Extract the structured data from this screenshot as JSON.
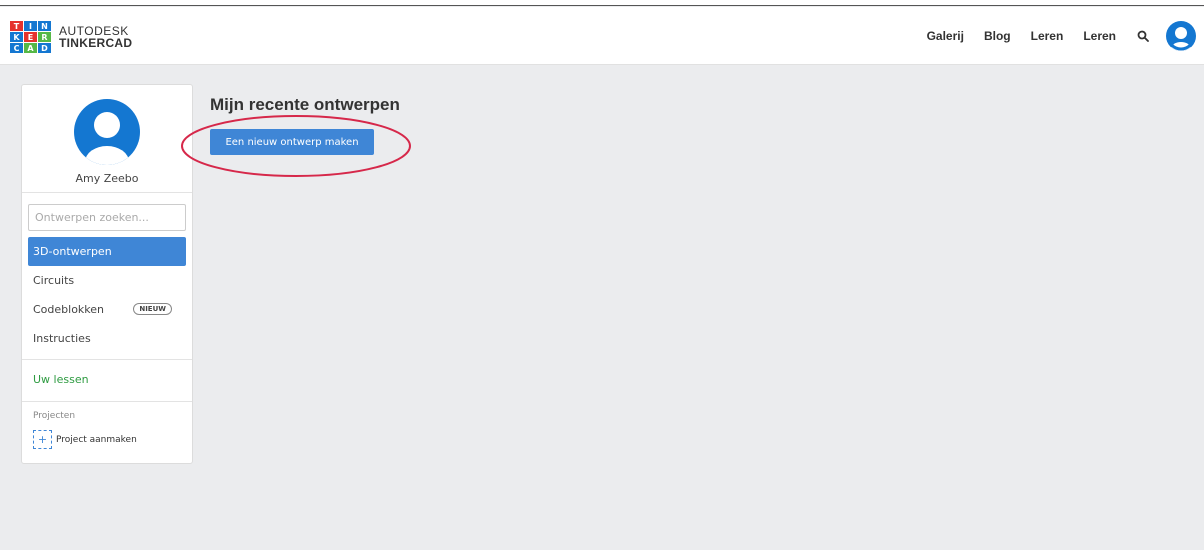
{
  "logo": {
    "letters": [
      "T",
      "I",
      "N",
      "K",
      "E",
      "R",
      "C",
      "A",
      "D"
    ],
    "line1": "AUTODESK",
    "line2": "TINKERCAD",
    "colors": [
      "#e5322d",
      "#1477d1",
      "#1477d1",
      "#1477d1",
      "#e5322d",
      "#56b847",
      "#1477d1",
      "#56b847",
      "#1477d1"
    ]
  },
  "nav": {
    "items": [
      "Galerij",
      "Blog",
      "Leren",
      "Leren"
    ],
    "search_icon": "search-icon",
    "avatar_icon": "user-avatar-icon"
  },
  "profile": {
    "name": "Amy Zeebo",
    "avatar_icon": "user-avatar-icon"
  },
  "search": {
    "placeholder": "Ontwerpen zoeken..."
  },
  "menu": {
    "items": [
      {
        "label": "3D-ontwerpen",
        "active": true
      },
      {
        "label": "Circuits",
        "active": false
      },
      {
        "label": "Codeblokken",
        "active": false,
        "badge": "NIEUW"
      },
      {
        "label": "Instructies",
        "active": false
      }
    ]
  },
  "lessons": {
    "label": "Uw lessen"
  },
  "projects": {
    "label": "Projecten",
    "create_label": "Project aanmaken"
  },
  "main": {
    "title": "Mijn recente ontwerpen",
    "new_button": "Een nieuw ontwerp maken"
  },
  "colors": {
    "accent": "#3f86d6",
    "brand_blue": "#1477d1",
    "green": "#2e9b41",
    "annotation": "#d6284a"
  }
}
